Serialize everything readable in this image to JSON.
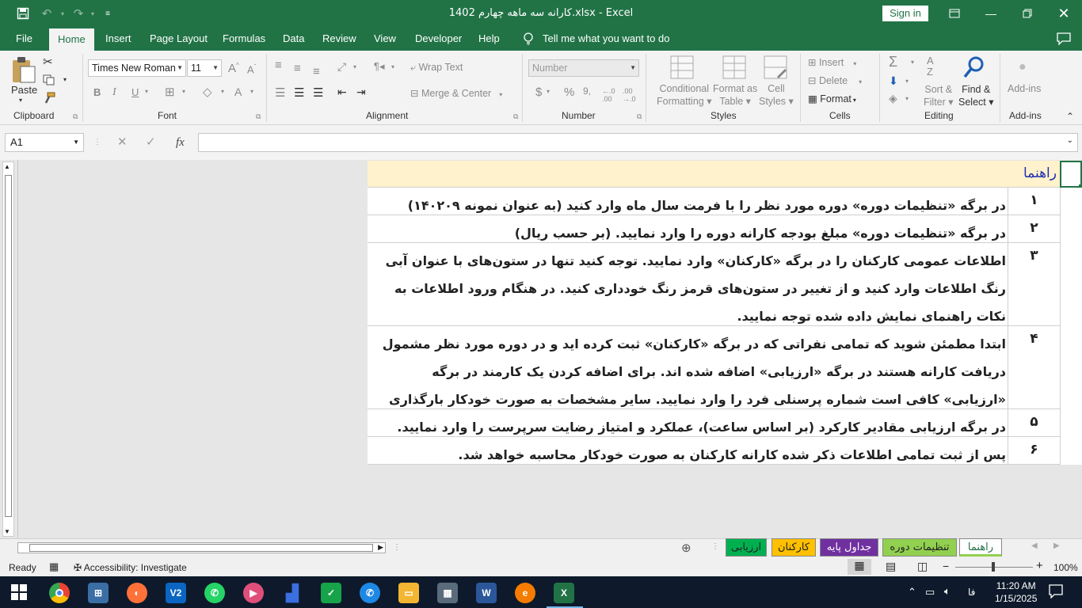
{
  "window": {
    "title": "کارانه سه ماهه چهارم 1402.xlsx  -  Excel",
    "sign_in": "Sign in"
  },
  "menu": {
    "tabs": [
      "File",
      "Home",
      "Insert",
      "Page Layout",
      "Formulas",
      "Data",
      "Review",
      "View",
      "Developer",
      "Help"
    ],
    "active": "Home",
    "tell_me": "Tell me what you want to do"
  },
  "ribbon": {
    "clipboard": {
      "label": "Clipboard",
      "paste": "Paste"
    },
    "font": {
      "label": "Font",
      "family": "Times New Roman",
      "size": "11",
      "bold": "B",
      "italic": "I",
      "underline": "U"
    },
    "alignment": {
      "label": "Alignment",
      "wrap_text": "Wrap Text",
      "merge_center": "Merge & Center"
    },
    "number": {
      "label": "Number",
      "format": "Number",
      "currency": "$",
      "percent": "%"
    },
    "styles": {
      "label": "Styles",
      "conditional": "Conditional",
      "formatting": "Formatting",
      "format_as": "Format as",
      "table": "Table",
      "cell": "Cell",
      "cell_styles": "Styles"
    },
    "cells": {
      "label": "Cells",
      "insert": "Insert",
      "delete": "Delete",
      "format": "Format"
    },
    "editing": {
      "label": "Editing",
      "sort": "Sort &",
      "filter": "Filter",
      "find": "Find &",
      "select": "Select"
    },
    "addins": {
      "label": "Add-ins",
      "addins_btn": "Add-ins"
    }
  },
  "formula_bar": {
    "name_box": "A1",
    "fx": "fx",
    "formula": ""
  },
  "sheet": {
    "header": "راهنما",
    "rows": [
      {
        "num": "۱",
        "text": "در برگه «تنظیمات دوره» دوره مورد نظر را با فرمت سال ماه وارد کنید (به عنوان نمونه ۱۴۰۲۰۹)"
      },
      {
        "num": "۲",
        "text": "در برگه «تنظیمات دوره» مبلغ بودجه کارانه دوره را وارد نمایید. (بر حسب ریال)"
      },
      {
        "num": "۳",
        "text": "اطلاعات عمومی کارکنان را در برگه «کارکنان» وارد نمایید. توجه کنید تنها در ستون‌های با عنوان آبی رنگ اطلاعات وارد کنید و از تغییر در ستون‌های قرمز رنگ خودداری کنید. در هنگام ورود اطلاعات به نکات راهنمای نمایش داده شده توجه نمایید."
      },
      {
        "num": "۴",
        "text": "ابتدا مطمئن شوید که تمامی نفراتی که در برگه «کارکنان» ثبت کرده اید و در دوره مورد نظر مشمول دریافت کارانه هستند در برگه «ارزیابی» اضافه شده اند. برای اضافه کردن یک کارمند در برگه «ارزیابی» کافی است شماره پرسنلی فرد را وارد نمایید. سایر مشخصات به صورت خودکار بارگذاری خواهد شد."
      },
      {
        "num": "۵",
        "text": "در برگه ارزیابی مقادیر کارکرد (بر اساس ساعت)، عملکرد و امتیاز رضایت سرپرست را وارد نمایید."
      },
      {
        "num": "۶",
        "text": "پس از ثبت تمامی اطلاعات ذکر شده کارانه کارکنان به صورت خودکار محاسبه خواهد شد."
      }
    ]
  },
  "sheet_tabs": [
    {
      "name": "راهنما",
      "color": "#ffffff",
      "active": true
    },
    {
      "name": "تنظیمات دوره",
      "color": "#92d050"
    },
    {
      "name": "جداول پایه",
      "color": "#7030a0"
    },
    {
      "name": "کارکنان",
      "color": "#ffc000"
    },
    {
      "name": "ارزیابی",
      "color": "#00b050"
    }
  ],
  "status": {
    "ready": "Ready",
    "accessibility": "Accessibility: Investigate",
    "zoom": "100%"
  },
  "taskbar": {
    "time": "11:20 AM",
    "date": "1/15/2025",
    "lang": "فا"
  }
}
